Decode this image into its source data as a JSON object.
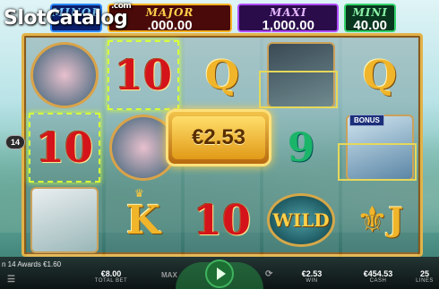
{
  "logo": {
    "text": "SlotCatalog",
    "suffix": ".com"
  },
  "jackpots": [
    {
      "label": "MINOR",
      "value": ""
    },
    {
      "label": "MAJOR",
      "value": ".000.00"
    },
    {
      "label": "MAXI",
      "value": "1,000.00"
    },
    {
      "label": "MINI",
      "value": "40.00"
    }
  ],
  "reels": {
    "r1": [
      "",
      "10",
      ""
    ],
    "r2": [
      "10",
      "",
      "K"
    ],
    "r3": [
      "Q",
      "",
      "10"
    ],
    "r4": [
      "",
      "9",
      "WILD"
    ],
    "r5": [
      "Q",
      "",
      "J"
    ]
  },
  "blue_tag": "BONUS",
  "win": {
    "amount": "€2.53"
  },
  "payline_number": "14",
  "bottom": {
    "message": "n 14 Awards €1.60",
    "total_bet": {
      "value": "€8.00",
      "label": "TOTAL BET"
    },
    "max_label": "MAX",
    "win": {
      "value": "€2.53",
      "label": "WIN"
    },
    "cash": {
      "value": "€454.53",
      "label": "CASH"
    },
    "lines": {
      "value": "25",
      "label": "LINES"
    }
  },
  "colors": {
    "accent": "#e2b34a",
    "win_highlight": "#d8ff3a",
    "spin": "#1d6e33"
  }
}
